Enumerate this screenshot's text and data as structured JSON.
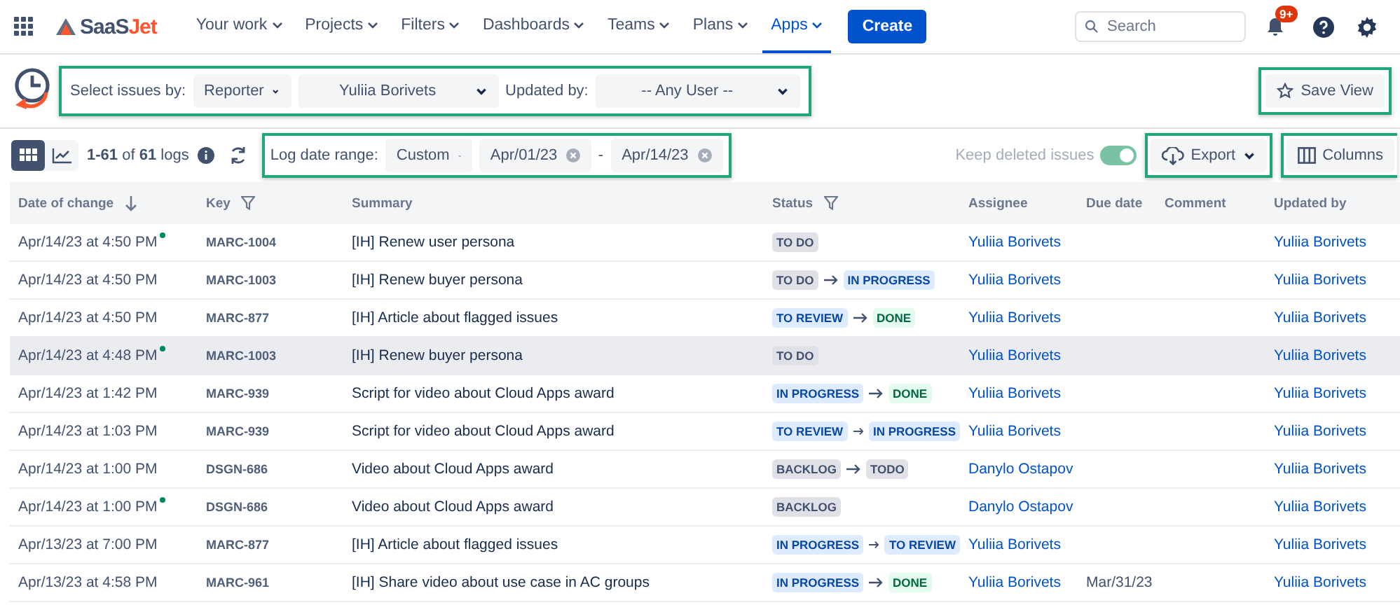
{
  "nav": {
    "logo_main": "SaaS",
    "logo_accent": "Jet",
    "items": [
      {
        "label": "Your work",
        "selected": false
      },
      {
        "label": "Projects",
        "selected": false
      },
      {
        "label": "Filters",
        "selected": false
      },
      {
        "label": "Dashboards",
        "selected": false
      },
      {
        "label": "Teams",
        "selected": false
      },
      {
        "label": "Plans",
        "selected": false
      },
      {
        "label": "Apps",
        "selected": true
      }
    ],
    "create": "Create",
    "search": {
      "placeholder": "Search"
    },
    "badge": "9+"
  },
  "filters": {
    "select_label": "Select issues by:",
    "select_value": "Reporter",
    "user_value": "Yuliia Borivets",
    "updated_label": "Updated by:",
    "updated_value": "-- Any User --",
    "save_view": "Save View"
  },
  "toolbar": {
    "views": [
      {
        "kind": "table",
        "selected": true
      },
      {
        "kind": "chart",
        "selected": false
      }
    ],
    "count": "**1-61** of **61** logs",
    "range_label": "Log date range:",
    "range_value": "Custom",
    "date_from": "Apr/01/23",
    "date_sep": "-",
    "date_to": "Apr/14/23",
    "keep_deleted": {
      "label": "Keep deleted issues",
      "on": true
    },
    "export": "Export",
    "columns": "Columns"
  },
  "table": {
    "columns": [
      "Date of change",
      "Key",
      "Summary",
      "Status",
      "Assignee",
      "Due date",
      "Comment",
      "Updated by"
    ],
    "rows": [
      {
        "date": "Apr/14/23 at 4:50 PM",
        "new": true,
        "highlighted": false,
        "key": "MARC-1004",
        "summary": "[IH] Renew user persona",
        "status": [
          {
            "label": "TO DO",
            "kind": "todo"
          }
        ],
        "assignee": "Yuliia Borivets",
        "updated_by": "Yuliia Borivets"
      },
      {
        "date": "Apr/14/23 at 4:50 PM",
        "new": false,
        "highlighted": false,
        "key": "MARC-1003",
        "summary": "[IH] Renew buyer persona",
        "status": [
          {
            "label": "TO DO",
            "kind": "todo"
          },
          {
            "label": "IN PROGRESS",
            "kind": "progress"
          }
        ],
        "assignee": "Yuliia Borivets",
        "updated_by": "Yuliia Borivets"
      },
      {
        "date": "Apr/14/23 at 4:50 PM",
        "new": false,
        "highlighted": false,
        "key": "MARC-877",
        "summary": "[IH] Article about flagged issues",
        "status": [
          {
            "label": "TO REVIEW",
            "kind": "progress"
          },
          {
            "label": "DONE",
            "kind": "done"
          }
        ],
        "assignee": "Yuliia Borivets",
        "updated_by": "Yuliia Borivets"
      },
      {
        "date": "Apr/14/23 at 4:48 PM",
        "new": true,
        "highlighted": true,
        "key": "MARC-1003",
        "summary": "[IH] Renew buyer persona",
        "status": [
          {
            "label": "TO DO",
            "kind": "todo"
          }
        ],
        "assignee": "Yuliia Borivets",
        "updated_by": "Yuliia Borivets"
      },
      {
        "date": "Apr/14/23 at 1:42 PM",
        "new": false,
        "highlighted": false,
        "key": "MARC-939",
        "summary": "Script for video about Cloud Apps award",
        "status": [
          {
            "label": "IN PROGRESS",
            "kind": "progress"
          },
          {
            "label": "DONE",
            "kind": "done"
          }
        ],
        "assignee": "Yuliia Borivets",
        "updated_by": "Yuliia Borivets"
      },
      {
        "date": "Apr/14/23 at 1:03 PM",
        "new": false,
        "highlighted": false,
        "key": "MARC-939",
        "summary": "Script for video about Cloud Apps award",
        "status": [
          {
            "label": "TO REVIEW",
            "kind": "progress"
          },
          {
            "label": "IN PROGRESS",
            "kind": "progress"
          }
        ],
        "assignee": "Yuliia Borivets",
        "updated_by": "Yuliia Borivets"
      },
      {
        "date": "Apr/14/23 at 1:00 PM",
        "new": false,
        "highlighted": false,
        "key": "DSGN-686",
        "summary": "Video about Cloud Apps award",
        "status": [
          {
            "label": "BACKLOG",
            "kind": "todo"
          },
          {
            "label": "TODO",
            "kind": "todo"
          }
        ],
        "assignee": "Danylo Ostapov",
        "updated_by": "Yuliia Borivets"
      },
      {
        "date": "Apr/14/23 at 1:00 PM",
        "new": true,
        "highlighted": false,
        "key": "DSGN-686",
        "summary": "Video about Cloud Apps award",
        "status": [
          {
            "label": "BACKLOG",
            "kind": "todo"
          }
        ],
        "assignee": "Danylo Ostapov",
        "updated_by": "Yuliia Borivets"
      },
      {
        "date": "Apr/13/23 at 7:00 PM",
        "new": false,
        "highlighted": false,
        "key": "MARC-877",
        "summary": "[IH] Article about flagged issues",
        "status": [
          {
            "label": "IN PROGRESS",
            "kind": "progress"
          },
          {
            "label": "TO REVIEW",
            "kind": "progress"
          }
        ],
        "assignee": "Yuliia Borivets",
        "updated_by": "Yuliia Borivets"
      },
      {
        "date": "Apr/13/23 at 4:58 PM",
        "new": false,
        "highlighted": false,
        "key": "MARC-961",
        "summary": "[IH] Share video about use case in AC groups",
        "status": [
          {
            "label": "IN PROGRESS",
            "kind": "progress"
          },
          {
            "label": "DONE",
            "kind": "done"
          }
        ],
        "assignee": "Yuliia Borivets",
        "due": "Mar/31/23",
        "updated_by": "Yuliia Borivets"
      }
    ]
  }
}
